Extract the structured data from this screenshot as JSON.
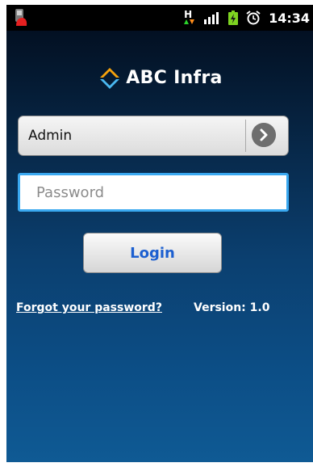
{
  "status_bar": {
    "time": "14:34",
    "icons": [
      "app-notification-icon",
      "hspa-data-icon",
      "signal-icon",
      "battery-charging-icon",
      "alarm-icon"
    ]
  },
  "brand": {
    "name": "ABC Infra",
    "logo_icon": "diamond-logo-icon"
  },
  "user_select": {
    "selected": "Admin"
  },
  "password_field": {
    "value": "",
    "placeholder": "Password"
  },
  "login_button": {
    "label": "Login"
  },
  "footer": {
    "forgot_label": "Forgot your password?",
    "version_label": "Version: 1.0"
  },
  "colors": {
    "accent_blue": "#3aa8f0",
    "login_text": "#1c5fd0",
    "logo_orange": "#f5a20c",
    "logo_blue": "#4ab8f0"
  }
}
